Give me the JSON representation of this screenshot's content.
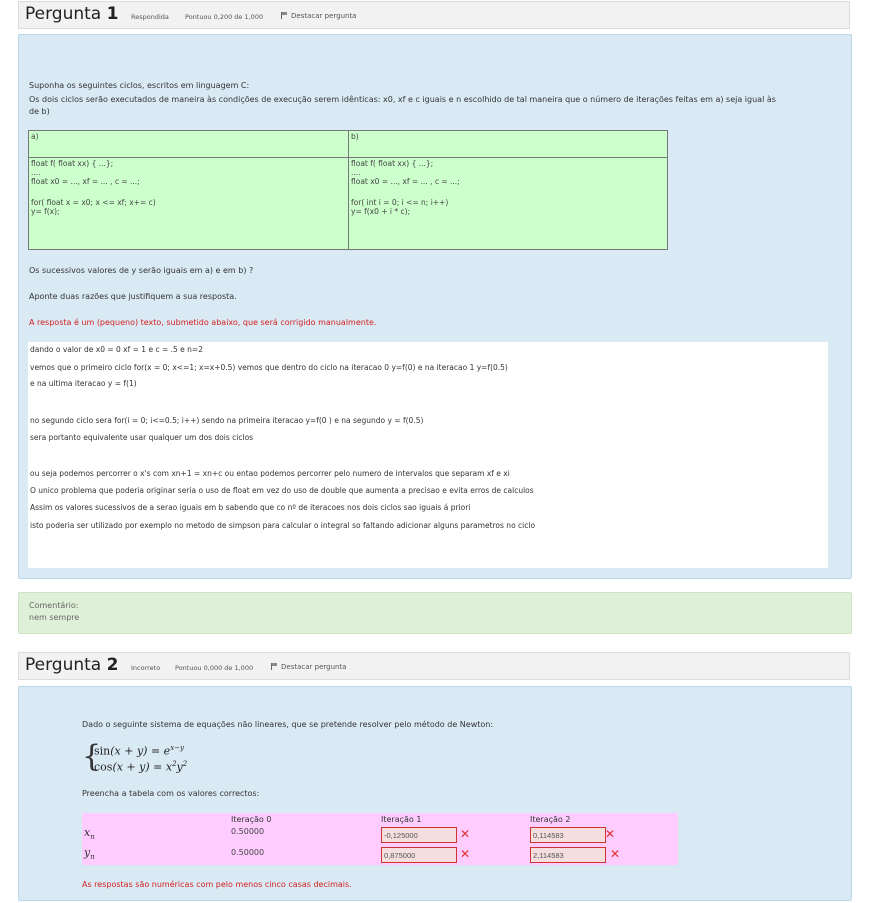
{
  "q1": {
    "title_word": "Pergunta",
    "title_num": "1",
    "status": "Respondida",
    "score": "Pontuou 0,200 de 1,000",
    "flag_label": "Destacar pergunta",
    "intro1": "Suponha os seguintes ciclos, escritos em linguagem C:",
    "intro2": "Os dois ciclos serão executados de maneira às condições de execução serem idênticas: x0, xf e c iguais e n escolhido de tal maneira que o número de iterações feitas em a) seja igual às",
    "intro3": "de b)",
    "table": {
      "a_header": "a)",
      "b_header": "b)",
      "a_lines": [
        "float f( float xx) { ...};",
        "....",
        "float x0 = ..., xf = ... , c = ...;",
        "",
        "for( float x = x0; x <= xf; x+= c)",
        "y= f(x);"
      ],
      "b_lines": [
        "float f( float xx) { ...};",
        "....",
        "float x0 = ..., xf = ... , c = ...;",
        "",
        "for( int i = 0; i <= n; i++)",
        "y= f(x0 + i * c);"
      ]
    },
    "question": "Os sucessivos valores de y serão iguais em a) e em b) ?",
    "ask": "Aponte duas razões que justifiquem a sua resposta.",
    "note": "A resposta é um (pequeno) texto, submetido abaixo, que será corrigido manualmente.",
    "answer_lines": [
      "dando o valor de x0 = 0 xf = 1 e c = .5 e n=2",
      "vemos que o primeiro ciclo for(x = 0; x<=1; x=x+0.5) vemos que dentro do ciclo na iteracao 0 y=f(0) e na iteracao 1 y=f(0.5)",
      "e na ultima iteracao y = f(1)",
      "no segundo ciclo sera for(i = 0; i<=0.5; i++) sendo na primeira iteracao y=f(0 ) e na segundo y = f(0.5)",
      "sera portanto equivalente usar qualquer um dos dois ciclos",
      "ou seja podemos percorrer o x's com xn+1 = xn+c ou entao podemos percorrer pelo numero de intervalos que separam xf e xi",
      "O unico problema que poderia originar seria o uso de float em vez do uso de double que aumenta a precisao e evita erros de calculos",
      "Assim os valores sucessivos de a serao iguais em b sabendo que co nº de iteracoes nos dois ciclos sao iguais á priori",
      "isto poderia ser utilizado por exemplo no metodo de simpson para calcular o integral so faltando adicionar alguns parametros no ciclo"
    ],
    "comment_label": "Comentário:",
    "comment_text": "nem sempre"
  },
  "q2": {
    "title_word": "Pergunta",
    "title_num": "2",
    "status": "Incorreto",
    "score": "Pontuou 0,000 de 1,000",
    "flag_label": "Destacar pergunta",
    "intro": "Dado o seguinte sistema de equações não lineares, que se pretende resolver pelo método de Newton:",
    "fill": "Preencha a tabela com os valores correctos:",
    "headers": [
      "Iteração 0",
      "Iteração 1",
      "Iteração 2"
    ],
    "row_x": {
      "label": "xn",
      "iter0": "0.50000",
      "iter1": "-0,125000",
      "iter2": "0,114583"
    },
    "row_y": {
      "label": "yn",
      "iter0": "0.50000",
      "iter1": "0,875000",
      "iter2": "2,114583"
    },
    "note": "As respostas são numéricas com pelo menos cinco casas decimais."
  },
  "colors": {
    "panel_bg": "#daeaf5",
    "code_bg": "#ccffcc",
    "table_bg": "#ffccff",
    "error": "#d42020",
    "comment_bg": "#dff0d8"
  }
}
